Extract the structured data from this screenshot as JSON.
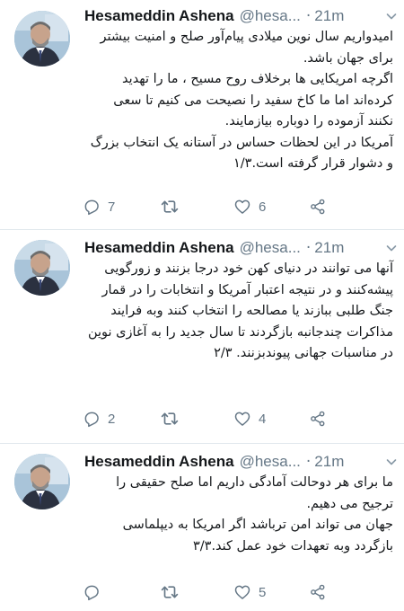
{
  "author": {
    "name": "Hesameddin Ashena",
    "handle_truncated": "@hesa...",
    "separator": "·"
  },
  "tweets": [
    {
      "time": "21m",
      "paragraphs": [
        "امیدواریم سال نوین میلادی پیام‌آور صلح و امنیت بیشتر برای جهان باشد.",
        "اگرچه امریکایی ها برخلاف روح مسیح ، ما را تهدید کرده‌اند اما ما کاخ سفید را نصیحت می کنیم تا سعی نکنند آزموده را دوباره بیازمایند.",
        "آمریکا در این لحظات حساس در آستانه یک انتخاب بزرگ و دشوار قرار گرفته است.۱/۳"
      ],
      "reply_count": "7",
      "retweet_count": "",
      "like_count": "6"
    },
    {
      "time": "21m",
      "paragraphs": [
        "آنها می توانند در دنیای کهن خود درجا بزنند و زورگویی پیشه‌کنند و در نتیجه اعتبار آمریکا و انتخابات را در قمار جنگ طلبی ببازند یا مصالحه را انتخاب کنند وبه فرایند مذاکرات چندجانبه بازگردند تا سال جدید را به آغازی نوین در مناسبات جهانی پیوندبزنند. ۲/۳"
      ],
      "reply_count": "2",
      "retweet_count": "",
      "like_count": "4"
    },
    {
      "time": "21m",
      "paragraphs": [
        "ما برای هر دوحالت آمادگی داریم اما صلح حقیقی را ترجیح می دهیم.",
        "جهان می تواند امن ترباشد اگر امریکا به دیپلماسی بازگردد وبه تعهدات خود عمل کند.۳/۳"
      ],
      "reply_count": "",
      "retweet_count": "",
      "like_count": "5"
    }
  ],
  "icons": {
    "reply": "reply-icon",
    "retweet": "retweet-icon",
    "like": "heart-icon",
    "share": "share-icon",
    "caret": "chevron-down-icon"
  },
  "colors": {
    "text": "#14171a",
    "muted": "#657786",
    "divider": "#e1e8ed"
  }
}
